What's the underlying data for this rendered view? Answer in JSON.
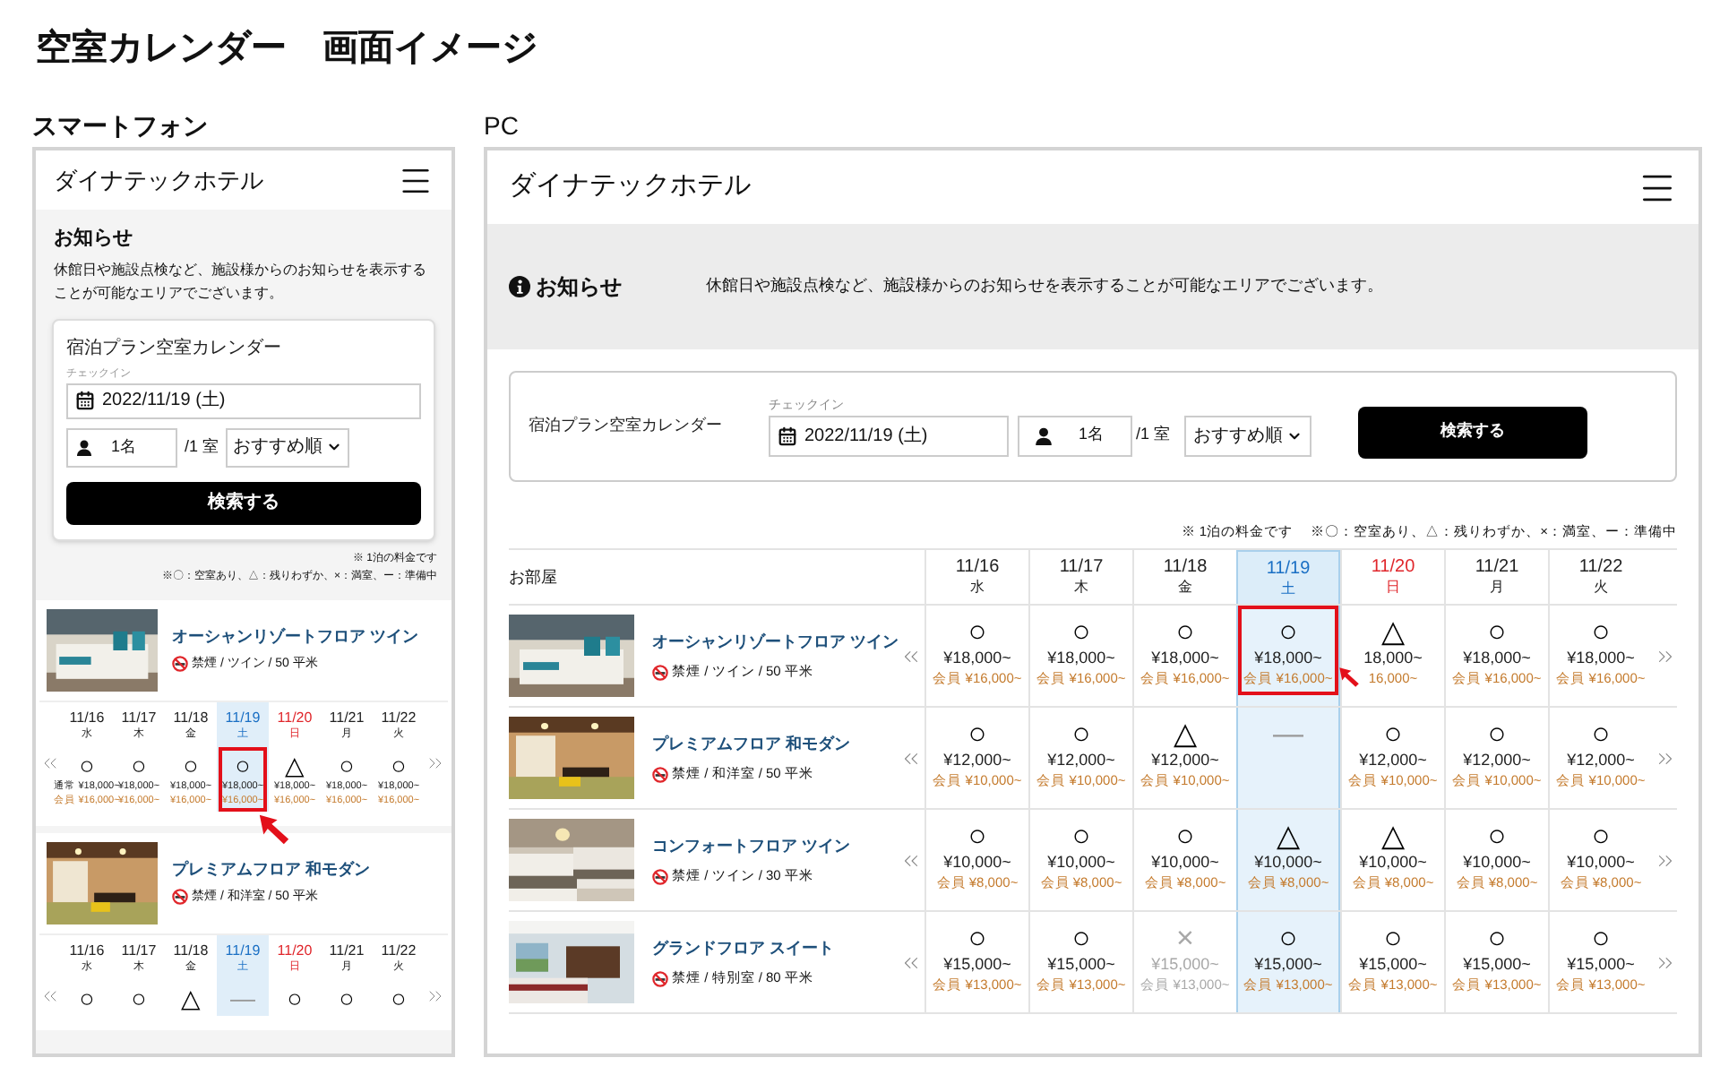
{
  "page_title": "空室カレンダー　画面イメージ",
  "smartphone": {
    "label": "スマートフォン",
    "hotel_name": "ダイナテックホテル",
    "notice": {
      "title": "お知らせ",
      "text": "休館日や施設点検など、施設様からのお知らせを表示することが可能なエリアでございます。"
    },
    "search": {
      "title": "宿泊プラン空室カレンダー",
      "checkin_label": "チェックイン",
      "date": "2022/11/19 (土)",
      "guests": "1名",
      "rooms": "/1 室",
      "sort": "おすすめ順",
      "button": "検索する"
    },
    "legend": [
      "※ 1泊の料金です",
      "※〇：空室あり、△：残りわずか、×：満室、ー：準備中"
    ],
    "rooms": [
      {
        "name": "オーシャンリゾートフロア ツイン",
        "spec": "禁煙 / ツイン / 50 平米",
        "days": [
          {
            "date": "11/16",
            "weekday": "水",
            "kind": "weekday",
            "selected": false
          },
          {
            "date": "11/17",
            "weekday": "木",
            "kind": "weekday",
            "selected": false
          },
          {
            "date": "11/18",
            "weekday": "金",
            "kind": "weekday",
            "selected": false
          },
          {
            "date": "11/19",
            "weekday": "土",
            "kind": "saturday",
            "selected": true
          },
          {
            "date": "11/20",
            "weekday": "日",
            "kind": "sunday",
            "selected": false
          },
          {
            "date": "11/21",
            "weekday": "月",
            "kind": "weekday",
            "selected": false
          },
          {
            "date": "11/22",
            "weekday": "火",
            "kind": "weekday",
            "selected": false
          }
        ],
        "cells": [
          {
            "kind": "available",
            "symbol": "○",
            "regular": "通常 ¥18,000~",
            "member": "会員 ¥16,000~",
            "marked": false
          },
          {
            "kind": "available",
            "symbol": "○",
            "regular": "¥18,000~",
            "member": "¥16,000~",
            "marked": false
          },
          {
            "kind": "available",
            "symbol": "○",
            "regular": "¥18,000~",
            "member": "¥16,000~",
            "marked": false
          },
          {
            "kind": "available",
            "symbol": "○",
            "regular": "¥18,000~",
            "member": "¥16,000~",
            "marked": true
          },
          {
            "kind": "few",
            "symbol": "△",
            "regular": "¥18,000~",
            "member": "¥16,000~",
            "marked": false
          },
          {
            "kind": "available",
            "symbol": "○",
            "regular": "¥18,000~",
            "member": "¥16,000~",
            "marked": false
          },
          {
            "kind": "available",
            "symbol": "○",
            "regular": "¥18,000~",
            "member": "¥16,000~",
            "marked": false
          }
        ]
      },
      {
        "name": "プレミアムフロア 和モダン",
        "spec": "禁煙 / 和洋室 / 50 平米",
        "days": [
          {
            "date": "11/16",
            "weekday": "水",
            "kind": "weekday",
            "selected": false
          },
          {
            "date": "11/17",
            "weekday": "木",
            "kind": "weekday",
            "selected": false
          },
          {
            "date": "11/18",
            "weekday": "金",
            "kind": "weekday",
            "selected": false
          },
          {
            "date": "11/19",
            "weekday": "土",
            "kind": "saturday",
            "selected": true
          },
          {
            "date": "11/20",
            "weekday": "日",
            "kind": "sunday",
            "selected": false
          },
          {
            "date": "11/21",
            "weekday": "月",
            "kind": "weekday",
            "selected": false
          },
          {
            "date": "11/22",
            "weekday": "火",
            "kind": "weekday",
            "selected": false
          }
        ],
        "cells": [
          {
            "kind": "available",
            "symbol": "○",
            "marked": false
          },
          {
            "kind": "available",
            "symbol": "○",
            "marked": false
          },
          {
            "kind": "few",
            "symbol": "△",
            "marked": false
          },
          {
            "kind": "preparing",
            "symbol": "—",
            "marked": false
          },
          {
            "kind": "available",
            "symbol": "○",
            "marked": false
          },
          {
            "kind": "available",
            "symbol": "○",
            "marked": false
          },
          {
            "kind": "available",
            "symbol": "○",
            "marked": false
          }
        ]
      }
    ]
  },
  "pc": {
    "label": "PC",
    "hotel_name": "ダイナテックホテル",
    "notice": {
      "title": "お知らせ",
      "text": "休館日や施設点検など、施設様からのお知らせを表示することが可能なエリアでございます。"
    },
    "search": {
      "title": "宿泊プラン空室カレンダー",
      "checkin_label": "チェックイン",
      "date": "2022/11/19 (土)",
      "guests": "1名",
      "rooms": "/1 室",
      "sort": "おすすめ順",
      "button": "検索する"
    },
    "legend": [
      "※ 1泊の料金です",
      "※〇：空室あり、△：残りわずか、×：満室、ー：準備中"
    ],
    "table": {
      "room_header": "お部屋",
      "days": [
        {
          "date": "11/16",
          "weekday": "水",
          "kind": "weekday",
          "selected": false
        },
        {
          "date": "11/17",
          "weekday": "木",
          "kind": "weekday",
          "selected": false
        },
        {
          "date": "11/18",
          "weekday": "金",
          "kind": "weekday",
          "selected": false
        },
        {
          "date": "11/19",
          "weekday": "土",
          "kind": "saturday",
          "selected": true
        },
        {
          "date": "11/20",
          "weekday": "日",
          "kind": "sunday",
          "selected": false
        },
        {
          "date": "11/21",
          "weekday": "月",
          "kind": "weekday",
          "selected": false
        },
        {
          "date": "11/22",
          "weekday": "火",
          "kind": "weekday",
          "selected": false
        }
      ],
      "rooms": [
        {
          "name": "オーシャンリゾートフロア ツイン",
          "spec": "禁煙 / ツイン / 50 平米",
          "cells": [
            {
              "kind": "available",
              "symbol": "○",
              "regular": "¥18,000~",
              "member": "会員 ¥16,000~",
              "marked": false
            },
            {
              "kind": "available",
              "symbol": "○",
              "regular": "¥18,000~",
              "member": "会員 ¥16,000~",
              "marked": false
            },
            {
              "kind": "available",
              "symbol": "○",
              "regular": "¥18,000~",
              "member": "会員 ¥16,000~",
              "marked": false
            },
            {
              "kind": "available",
              "symbol": "○",
              "regular": "¥18,000~",
              "member": "会員 ¥16,000~",
              "marked": true
            },
            {
              "kind": "few",
              "symbol": "△",
              "regular": "18,000~",
              "member": "16,000~",
              "marked": false
            },
            {
              "kind": "available",
              "symbol": "○",
              "regular": "¥18,000~",
              "member": "会員 ¥16,000~",
              "marked": false
            },
            {
              "kind": "available",
              "symbol": "○",
              "regular": "¥18,000~",
              "member": "会員 ¥16,000~",
              "marked": false
            }
          ]
        },
        {
          "name": "プレミアムフロア 和モダン",
          "spec": "禁煙 / 和洋室 / 50 平米",
          "cells": [
            {
              "kind": "available",
              "symbol": "○",
              "regular": "¥12,000~",
              "member": "会員 ¥10,000~",
              "marked": false
            },
            {
              "kind": "available",
              "symbol": "○",
              "regular": "¥12,000~",
              "member": "会員 ¥10,000~",
              "marked": false
            },
            {
              "kind": "few",
              "symbol": "△",
              "regular": "¥12,000~",
              "member": "会員 ¥10,000~",
              "marked": false
            },
            {
              "kind": "preparing",
              "symbol": "—",
              "marked": false
            },
            {
              "kind": "available",
              "symbol": "○",
              "regular": "¥12,000~",
              "member": "会員 ¥10,000~",
              "marked": false
            },
            {
              "kind": "available",
              "symbol": "○",
              "regular": "¥12,000~",
              "member": "会員 ¥10,000~",
              "marked": false
            },
            {
              "kind": "available",
              "symbol": "○",
              "regular": "¥12,000~",
              "member": "会員 ¥10,000~",
              "marked": false
            }
          ]
        },
        {
          "name": "コンフォートフロア ツイン",
          "spec": "禁煙 / ツイン / 30 平米",
          "cells": [
            {
              "kind": "available",
              "symbol": "○",
              "regular": "¥10,000~",
              "member": "会員 ¥8,000~",
              "marked": false
            },
            {
              "kind": "available",
              "symbol": "○",
              "regular": "¥10,000~",
              "member": "会員 ¥8,000~",
              "marked": false
            },
            {
              "kind": "available",
              "symbol": "○",
              "regular": "¥10,000~",
              "member": "会員 ¥8,000~",
              "marked": false
            },
            {
              "kind": "few",
              "symbol": "△",
              "regular": "¥10,000~",
              "member": "会員 ¥8,000~",
              "marked": false
            },
            {
              "kind": "few",
              "symbol": "△",
              "regular": "¥10,000~",
              "member": "会員 ¥8,000~",
              "marked": false
            },
            {
              "kind": "available",
              "symbol": "○",
              "regular": "¥10,000~",
              "member": "会員 ¥8,000~",
              "marked": false
            },
            {
              "kind": "available",
              "symbol": "○",
              "regular": "¥10,000~",
              "member": "会員 ¥8,000~",
              "marked": false
            }
          ]
        },
        {
          "name": "グランドフロア スイート",
          "spec": "禁煙 / 特別室 / 80 平米",
          "cells": [
            {
              "kind": "available",
              "symbol": "○",
              "regular": "¥15,000~",
              "member": "会員 ¥13,000~",
              "marked": false
            },
            {
              "kind": "available",
              "symbol": "○",
              "regular": "¥15,000~",
              "member": "会員 ¥13,000~",
              "marked": false
            },
            {
              "kind": "full",
              "symbol": "×",
              "regular": "¥15,000~",
              "member": "会員 ¥13,000~",
              "marked": false
            },
            {
              "kind": "available",
              "symbol": "○",
              "regular": "¥15,000~",
              "member": "会員 ¥13,000~",
              "marked": false
            },
            {
              "kind": "available",
              "symbol": "○",
              "regular": "¥15,000~",
              "member": "会員 ¥13,000~",
              "marked": false
            },
            {
              "kind": "available",
              "symbol": "○",
              "regular": "¥15,000~",
              "member": "会員 ¥13,000~",
              "marked": false
            },
            {
              "kind": "available",
              "symbol": "○",
              "regular": "¥15,000~",
              "member": "会員 ¥13,000~",
              "marked": false
            }
          ]
        }
      ]
    }
  }
}
